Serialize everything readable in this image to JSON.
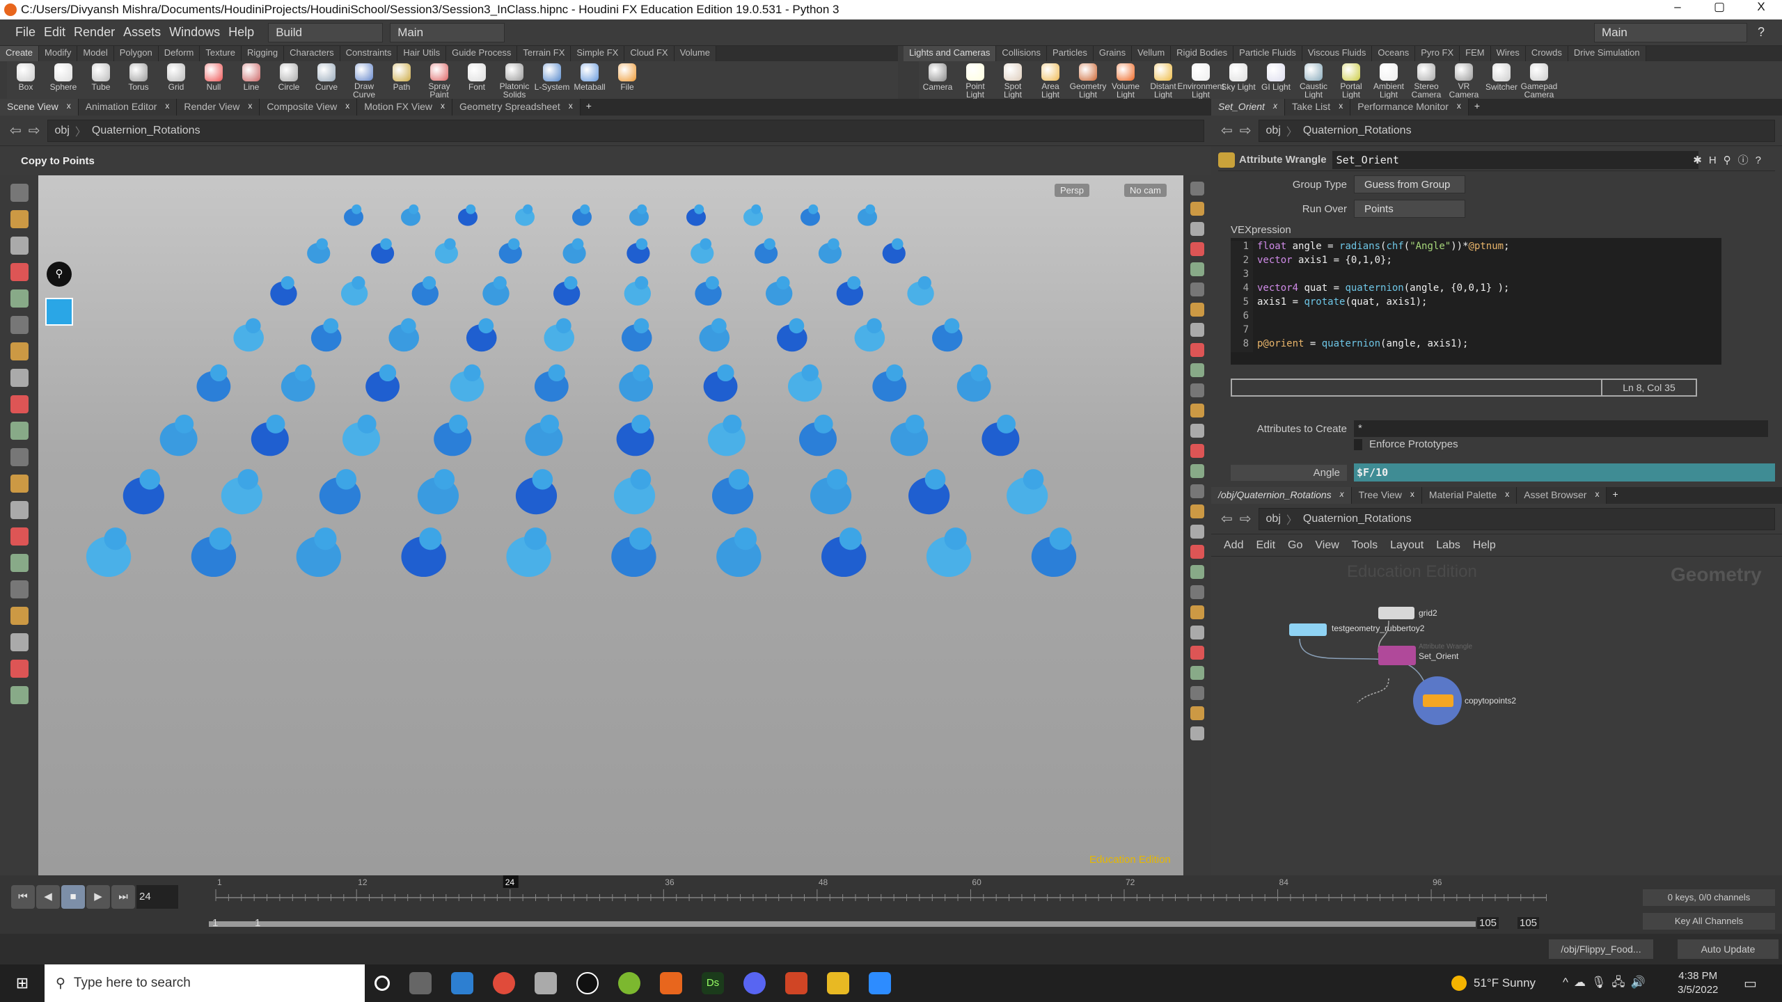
{
  "window": {
    "title": "C:/Users/Divyansh Mishra/Documents/HoudiniProjects/HoudiniSchool/Session3/Session3_InClass.hipnc - Houdini FX Education Edition 19.0.531 - Python 3",
    "minimize": "–",
    "maximize": "▢",
    "close": "X"
  },
  "menu": {
    "items": [
      "File",
      "Edit",
      "Render",
      "Assets",
      "Windows",
      "Help"
    ],
    "desktop": "Build",
    "context": "Main",
    "right_context": "Main"
  },
  "shelf_left": {
    "tabs": [
      "Create",
      "Modify",
      "Model",
      "Polygon",
      "Deform",
      "Texture",
      "Rigging",
      "Characters",
      "Constraints",
      "Hair Utils",
      "Guide Process",
      "Terrain FX",
      "Simple FX",
      "Cloud FX",
      "Volume"
    ],
    "tools": [
      "Box",
      "Sphere",
      "Tube",
      "Torus",
      "Grid",
      "Null",
      "Line",
      "Circle",
      "Curve",
      "Draw Curve",
      "Path",
      "Spray Paint",
      "Font",
      "Platonic Solids",
      "L-System",
      "Metaball",
      "File"
    ]
  },
  "shelf_right": {
    "tabs": [
      "Lights and Cameras",
      "Collisions",
      "Particles",
      "Grains",
      "Vellum",
      "Rigid Bodies",
      "Particle Fluids",
      "Viscous Fluids",
      "Oceans",
      "Pyro FX",
      "FEM",
      "Wires",
      "Crowds",
      "Drive Simulation"
    ],
    "tools": [
      "Camera",
      "Point Light",
      "Spot Light",
      "Area Light",
      "Geometry Light",
      "Volume Light",
      "Distant Light",
      "Environment Light",
      "Sky Light",
      "GI Light",
      "Caustic Light",
      "Portal Light",
      "Ambient Light",
      "Stereo Camera",
      "VR Camera",
      "Switcher",
      "Gamepad Camera"
    ]
  },
  "left_pane": {
    "tabs": [
      "Scene View",
      "Animation Editor",
      "Render View",
      "Composite View",
      "Motion FX View",
      "Geometry Spreadsheet"
    ],
    "path": [
      "obj",
      "Quaternion_Rotations"
    ],
    "tool_title": "Copy to Points",
    "persp": "Persp",
    "cam": "No cam",
    "watermark": "Education Edition"
  },
  "right_pane": {
    "tabs": [
      "Set_Orient",
      "Take List",
      "Performance Monitor"
    ],
    "path": [
      "obj",
      "Quaternion_Rotations"
    ]
  },
  "params": {
    "node_type": "Attribute Wrangle",
    "node_name": "Set_Orient",
    "group_type_label": "Group Type",
    "group_type": "Guess from Group",
    "run_over_label": "Run Over",
    "run_over": "Points",
    "vex_label": "VEXpression",
    "code": [
      [
        [
          "kw",
          "float"
        ],
        [
          "pl",
          " angle = "
        ],
        [
          "fn",
          "radians"
        ],
        [
          "pl",
          "("
        ],
        [
          "fn",
          "chf"
        ],
        [
          "pl",
          "("
        ],
        [
          "str",
          "\"Angle\""
        ],
        [
          "pl",
          "))*"
        ],
        [
          "attr",
          "@ptnum"
        ],
        [
          "pl",
          ";"
        ]
      ],
      [
        [
          "kw",
          "vector"
        ],
        [
          "pl",
          " axis1 = {0,1,0};"
        ]
      ],
      [],
      [
        [
          "kw",
          "vector4"
        ],
        [
          "pl",
          " quat = "
        ],
        [
          "fn",
          "quaternion"
        ],
        [
          "pl",
          "(angle, {0,0,1} );"
        ]
      ],
      [
        [
          "pl",
          "axis1 = "
        ],
        [
          "fn",
          "qrotate"
        ],
        [
          "pl",
          "(quat, axis1);"
        ]
      ],
      [],
      [],
      [
        [
          "attr",
          "p@orient"
        ],
        [
          "pl",
          " = "
        ],
        [
          "fn",
          "quaternion"
        ],
        [
          "pl",
          "(angle, axis1);"
        ]
      ]
    ],
    "cursor": "Ln 8, Col 35",
    "attrs_label": "Attributes to Create",
    "attrs": "*",
    "enforce_label": "Enforce Prototypes",
    "enforce": false,
    "angle_label": "Angle",
    "angle": "$F/10"
  },
  "network": {
    "tabs": [
      "/obj/Quaternion_Rotations",
      "Tree View",
      "Material Palette",
      "Asset Browser"
    ],
    "path": [
      "obj",
      "Quaternion_Rotations"
    ],
    "menu": [
      "Add",
      "Edit",
      "Go",
      "View",
      "Tools",
      "Layout",
      "Labs",
      "Help"
    ],
    "watermark": "Education Edition",
    "context_label": "Geometry",
    "nodes": [
      {
        "name": "testgeometry_rubbertoy2",
        "type": "",
        "color": "#8fd3f4"
      },
      {
        "name": "grid2",
        "type": "",
        "color": "#d8d8d8"
      },
      {
        "name": "Set_Orient",
        "type": "Attribute Wrangle",
        "color": "#b0499a"
      },
      {
        "name": "copytopoints2",
        "type": "",
        "color": "#f5a623"
      }
    ]
  },
  "timeline": {
    "current": "24",
    "ticks": [
      "1",
      "12",
      "24",
      "36",
      "48",
      "60",
      "72",
      "84",
      "96"
    ],
    "start": "1",
    "range_start": "1",
    "range_end": "105",
    "end": "105",
    "keys": "0 keys, 0/0 channels",
    "key_all": "Key All Channels"
  },
  "status": {
    "path": "/obj/Flippy_Food...",
    "update": "Auto Update"
  },
  "taskbar": {
    "search": "Type here to search",
    "weather": "51°F  Sunny",
    "time": "4:38 PM",
    "date": "3/5/2022"
  }
}
